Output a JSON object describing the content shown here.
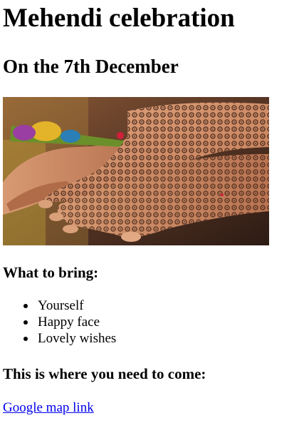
{
  "page": {
    "title": "Mehendi celebration",
    "subtitle": "On the 7th December"
  },
  "hero_image": {
    "icon": "henna-hands-photo",
    "colors": {
      "skin": "#c98a63",
      "henna": "#3b1e12",
      "background": "#5a3a28",
      "cone": "#6b8f2a"
    }
  },
  "bring": {
    "heading": "What to bring:",
    "items": [
      "Yourself",
      "Happy face",
      "Lovely wishes"
    ]
  },
  "location": {
    "heading": "This is where you need to come:",
    "link_text": "Google map link"
  },
  "colors": {
    "link": "#0000ee",
    "text": "#000000",
    "background": "#ffffff"
  }
}
